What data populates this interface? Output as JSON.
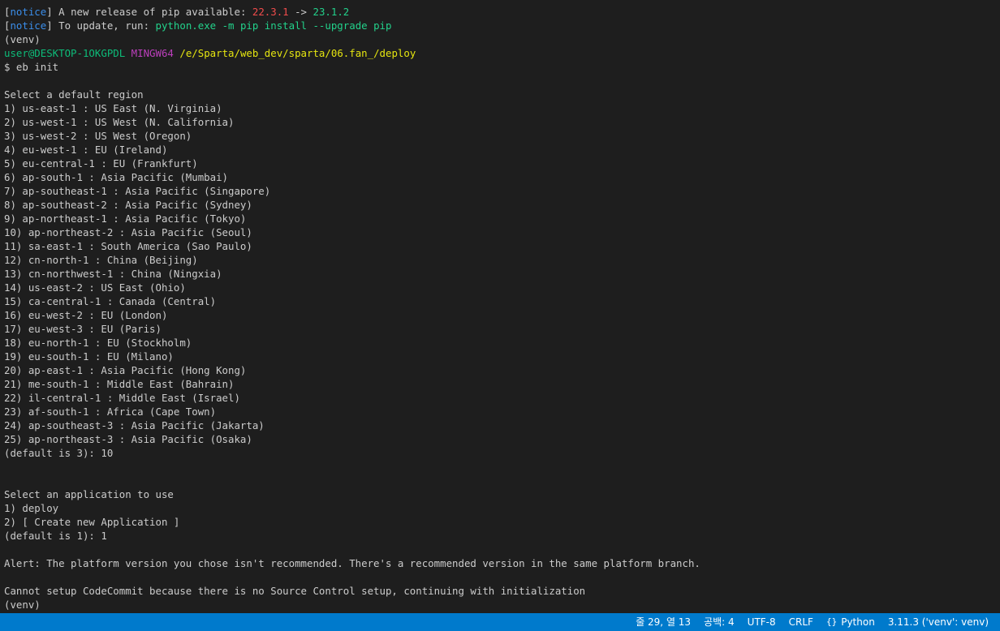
{
  "terminal": {
    "notice1": {
      "tag": "notice",
      "text": "A new release of pip available: ",
      "old": "22.3.1",
      "arrow": " -> ",
      "new": "23.1.2"
    },
    "notice2": {
      "tag": "notice",
      "text": "To update, run: ",
      "cmd": "python.exe -m pip install --upgrade pip"
    },
    "venv1": "(venv)",
    "prompt": {
      "user": "user@DESKTOP-1OKGPDL",
      "shell": "MINGW64",
      "path": "/e/Sparta/web_dev/sparta/06.fan_/deploy"
    },
    "command": "$ eb init",
    "region_heading": "Select a default region",
    "regions": [
      "1) us-east-1 : US East (N. Virginia)",
      "2) us-west-1 : US West (N. California)",
      "3) us-west-2 : US West (Oregon)",
      "4) eu-west-1 : EU (Ireland)",
      "5) eu-central-1 : EU (Frankfurt)",
      "6) ap-south-1 : Asia Pacific (Mumbai)",
      "7) ap-southeast-1 : Asia Pacific (Singapore)",
      "8) ap-southeast-2 : Asia Pacific (Sydney)",
      "9) ap-northeast-1 : Asia Pacific (Tokyo)",
      "10) ap-northeast-2 : Asia Pacific (Seoul)",
      "11) sa-east-1 : South America (Sao Paulo)",
      "12) cn-north-1 : China (Beijing)",
      "13) cn-northwest-1 : China (Ningxia)",
      "14) us-east-2 : US East (Ohio)",
      "15) ca-central-1 : Canada (Central)",
      "16) eu-west-2 : EU (London)",
      "17) eu-west-3 : EU (Paris)",
      "18) eu-north-1 : EU (Stockholm)",
      "19) eu-south-1 : EU (Milano)",
      "20) ap-east-1 : Asia Pacific (Hong Kong)",
      "21) me-south-1 : Middle East (Bahrain)",
      "22) il-central-1 : Middle East (Israel)",
      "23) af-south-1 : Africa (Cape Town)",
      "24) ap-southeast-3 : Asia Pacific (Jakarta)",
      "25) ap-northeast-3 : Asia Pacific (Osaka)"
    ],
    "region_choice": "(default is 3): 10",
    "app_heading": "Select an application to use",
    "apps": [
      "1) deploy",
      "2) [ Create new Application ]"
    ],
    "app_choice": "(default is 1): 1",
    "alert": "Alert: The platform version you chose isn't recommended. There's a recommended version in the same platform branch.",
    "codecommit": "Cannot setup CodeCommit because there is no Source Control setup, continuing with initialization",
    "venv2": "(venv)"
  },
  "statusbar": {
    "position": "줄 29, 열 13",
    "indent": "공백: 4",
    "encoding": "UTF-8",
    "eol": "CRLF",
    "language": "Python",
    "language_icon": "braces-icon",
    "interpreter": "3.11.3 ('venv': venv)",
    "color": "#007acc"
  }
}
